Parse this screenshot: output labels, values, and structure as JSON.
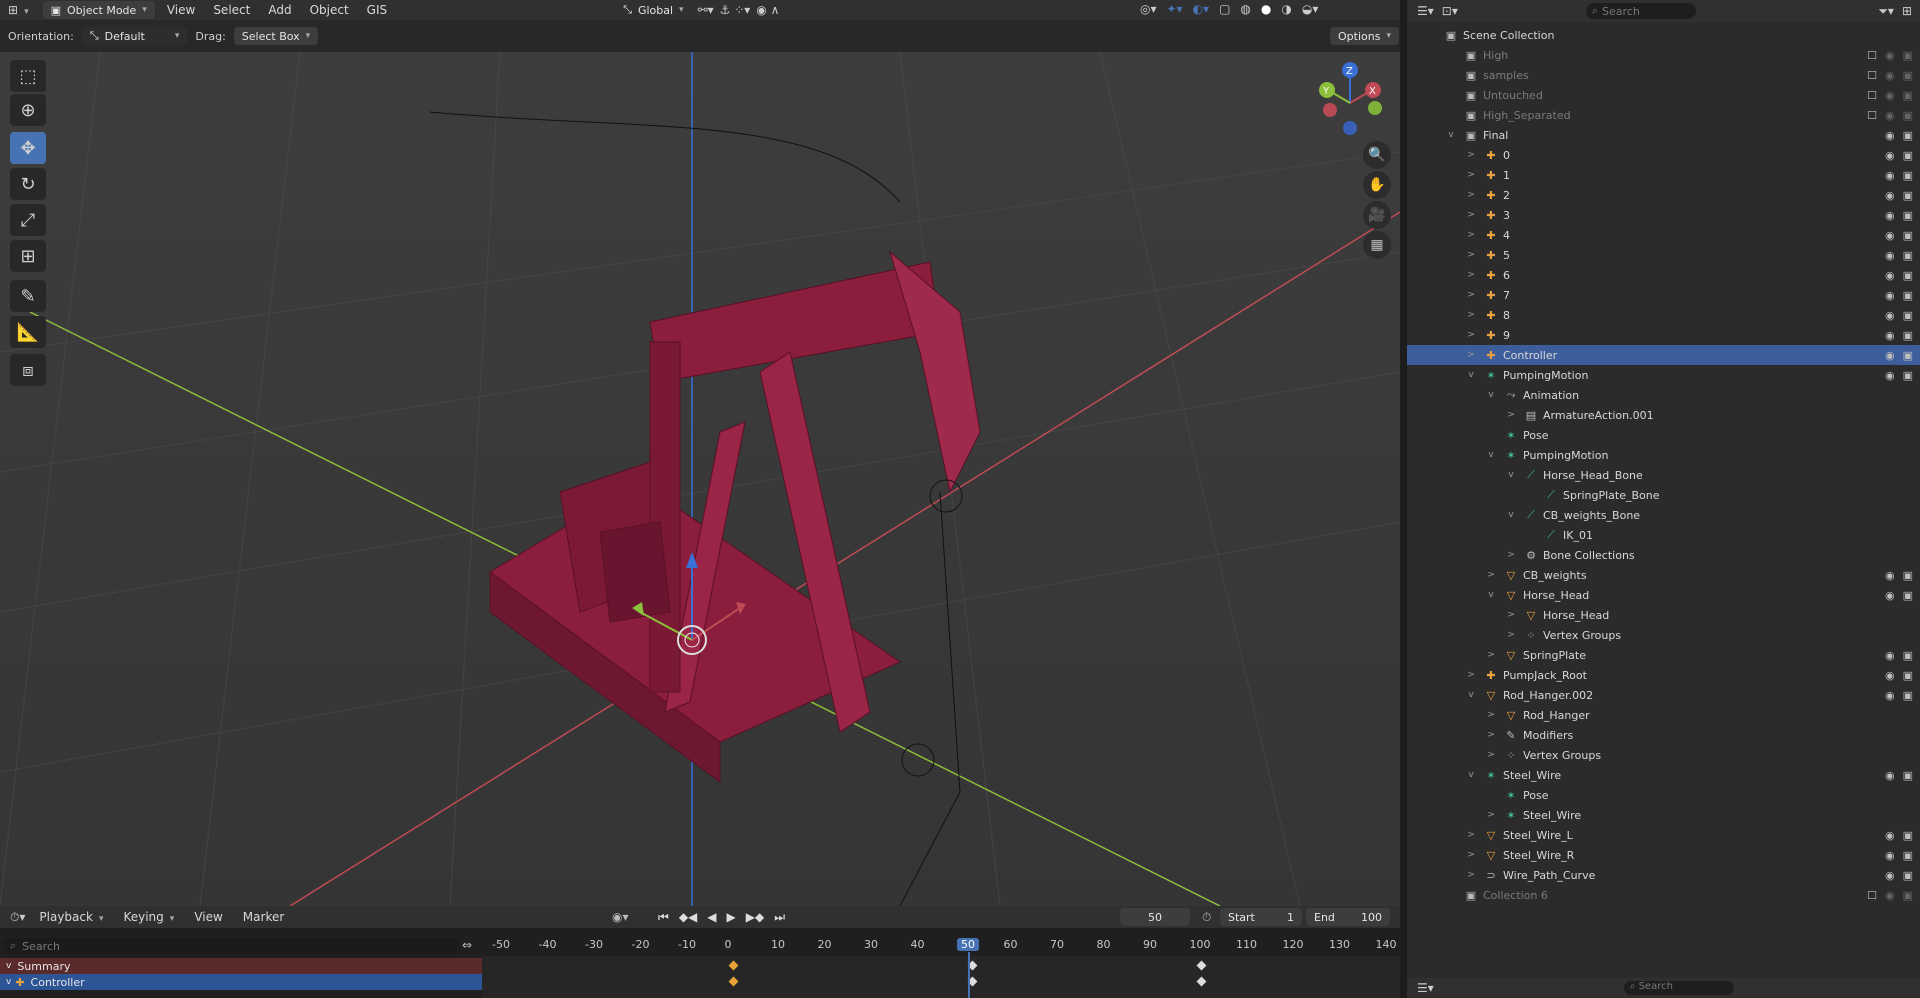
{
  "header": {
    "mode": "Object Mode",
    "menus": [
      "View",
      "Select",
      "Add",
      "Object",
      "GIS"
    ],
    "transform_orientation": "Global"
  },
  "toolbar": {
    "orientation_label": "Orientation:",
    "orientation_value": "Default",
    "drag_label": "Drag:",
    "drag_value": "Select Box",
    "options_label": "Options"
  },
  "tools": [
    "select-box-icon",
    "cursor-icon",
    "move-icon",
    "rotate-icon",
    "scale-icon",
    "transform-icon",
    "annotate-icon",
    "measure-icon",
    "add-cube-icon"
  ],
  "gizmo": {
    "x": "X",
    "y": "Y",
    "z": "Z"
  },
  "outliner": {
    "search_placeholder": "Search",
    "rows": [
      {
        "label": "Scene Collection",
        "indent": 0,
        "icon": "▣",
        "dim": false,
        "vis": false
      },
      {
        "label": "High",
        "indent": 1,
        "icon": "▣",
        "dim": true,
        "vis": false
      },
      {
        "label": "samples",
        "indent": 1,
        "icon": "▣",
        "dim": true,
        "vis": false
      },
      {
        "label": "Untouched",
        "indent": 1,
        "icon": "▣",
        "dim": true,
        "vis": false
      },
      {
        "label": "High_Separated",
        "indent": 1,
        "icon": "▣",
        "dim": true,
        "vis": false
      },
      {
        "label": "Final",
        "indent": 1,
        "icon": "▣",
        "expand": "v",
        "vis": true
      },
      {
        "label": "0",
        "indent": 2,
        "icon": "✚",
        "expand": ">",
        "vis": true
      },
      {
        "label": "1",
        "indent": 2,
        "icon": "✚",
        "expand": ">",
        "vis": true
      },
      {
        "label": "2",
        "indent": 2,
        "icon": "✚",
        "expand": ">",
        "vis": true
      },
      {
        "label": "3",
        "indent": 2,
        "icon": "✚",
        "expand": ">",
        "vis": true
      },
      {
        "label": "4",
        "indent": 2,
        "icon": "✚",
        "expand": ">",
        "vis": true
      },
      {
        "label": "5",
        "indent": 2,
        "icon": "✚",
        "expand": ">",
        "vis": true
      },
      {
        "label": "6",
        "indent": 2,
        "icon": "✚",
        "expand": ">",
        "vis": true
      },
      {
        "label": "7",
        "indent": 2,
        "icon": "✚",
        "expand": ">",
        "vis": true
      },
      {
        "label": "8",
        "indent": 2,
        "icon": "✚",
        "expand": ">",
        "vis": true
      },
      {
        "label": "9",
        "indent": 2,
        "icon": "✚",
        "expand": ">",
        "vis": true
      },
      {
        "label": "Controller",
        "indent": 2,
        "icon": "✚",
        "expand": ">",
        "vis": true,
        "sel": true
      },
      {
        "label": "PumpingMotion",
        "indent": 2,
        "icon": "✶",
        "expand": "v",
        "vis": true
      },
      {
        "label": "Animation",
        "indent": 3,
        "icon": "⤳",
        "expand": "v",
        "vis": false
      },
      {
        "label": "ArmatureAction.001",
        "indent": 4,
        "icon": "▤",
        "expand": ">",
        "vis": false
      },
      {
        "label": "Pose",
        "indent": 3,
        "icon": "✶",
        "vis": false
      },
      {
        "label": "PumpingMotion",
        "indent": 3,
        "icon": "✶",
        "expand": "v",
        "vis": false
      },
      {
        "label": "Horse_Head_Bone",
        "indent": 4,
        "icon": "⟋",
        "expand": "v",
        "vis": false
      },
      {
        "label": "SpringPlate_Bone",
        "indent": 5,
        "icon": "⟋",
        "vis": false
      },
      {
        "label": "CB_weights_Bone",
        "indent": 4,
        "icon": "⟋",
        "expand": "v",
        "vis": false
      },
      {
        "label": "IK_01",
        "indent": 5,
        "icon": "⟋",
        "vis": false
      },
      {
        "label": "Bone Collections",
        "indent": 4,
        "icon": "⚙",
        "expand": ">",
        "vis": false
      },
      {
        "label": "CB_weights",
        "indent": 3,
        "icon": "▽",
        "expand": ">",
        "vis": true
      },
      {
        "label": "Horse_Head",
        "indent": 3,
        "icon": "▽",
        "expand": "v",
        "vis": true
      },
      {
        "label": "Horse_Head",
        "indent": 4,
        "icon": "▽",
        "expand": ">",
        "vis": false
      },
      {
        "label": "Vertex Groups",
        "indent": 4,
        "icon": "⁘",
        "expand": ">",
        "vis": false
      },
      {
        "label": "SpringPlate",
        "indent": 3,
        "icon": "▽",
        "expand": ">",
        "vis": true
      },
      {
        "label": "PumpJack_Root",
        "indent": 2,
        "icon": "✚",
        "expand": ">",
        "vis": true
      },
      {
        "label": "Rod_Hanger.002",
        "indent": 2,
        "icon": "▽",
        "expand": "v",
        "vis": true
      },
      {
        "label": "Rod_Hanger",
        "indent": 3,
        "icon": "▽",
        "expand": ">",
        "vis": false
      },
      {
        "label": "Modifiers",
        "indent": 3,
        "icon": "✎",
        "expand": ">",
        "vis": false
      },
      {
        "label": "Vertex Groups",
        "indent": 3,
        "icon": "⁘",
        "expand": ">",
        "vis": false
      },
      {
        "label": "Steel_Wire",
        "indent": 2,
        "icon": "✶",
        "expand": "v",
        "vis": true
      },
      {
        "label": "Pose",
        "indent": 3,
        "icon": "✶",
        "vis": false
      },
      {
        "label": "Steel_Wire",
        "indent": 3,
        "icon": "✶",
        "expand": ">",
        "vis": false
      },
      {
        "label": "Steel_Wire_L",
        "indent": 2,
        "icon": "▽",
        "expand": ">",
        "vis": true
      },
      {
        "label": "Steel_Wire_R",
        "indent": 2,
        "icon": "▽",
        "expand": ">",
        "vis": true
      },
      {
        "label": "Wire_Path_Curve",
        "indent": 2,
        "icon": "⊃",
        "expand": ">",
        "vis": true
      },
      {
        "label": "Collection 6",
        "indent": 1,
        "icon": "▣",
        "dim": true,
        "vis": false
      }
    ],
    "footer_search": "Search"
  },
  "timeline": {
    "menus": [
      "Playback",
      "Keying",
      "View",
      "Marker"
    ],
    "current_frame": "50",
    "start_label": "Start",
    "start_value": "1",
    "end_label": "End",
    "end_value": "100",
    "search_placeholder": "Search",
    "ticks": [
      "-50",
      "-40",
      "-30",
      "-20",
      "-10",
      "0",
      "10",
      "20",
      "30",
      "40",
      "50",
      "60",
      "70",
      "80",
      "90",
      "100",
      "110",
      "120",
      "130",
      "140"
    ],
    "channels": [
      "Summary",
      "Controller"
    ]
  },
  "colors": {
    "accent": "#4772b3",
    "model": "#8a1e3c",
    "x_axis": "#c04a55",
    "y_axis": "#8cbf3a",
    "z_axis": "#3a6fd8"
  }
}
